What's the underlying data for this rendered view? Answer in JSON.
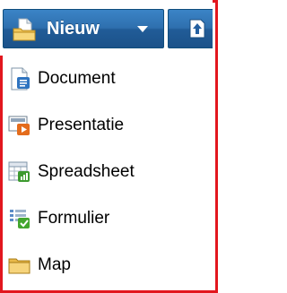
{
  "toolbar": {
    "new_button": {
      "label": "Nieuw",
      "icon": "new-document-folder-icon",
      "caret_icon": "caret-down-icon"
    },
    "upload_button": {
      "icon": "upload-arrow-icon"
    }
  },
  "menu": {
    "items": [
      {
        "label": "Document",
        "icon": "document-icon"
      },
      {
        "label": "Presentatie",
        "icon": "presentation-icon"
      },
      {
        "label": "Spreadsheet",
        "icon": "spreadsheet-icon"
      },
      {
        "label": "Formulier",
        "icon": "form-icon"
      },
      {
        "label": "Map",
        "icon": "folder-icon"
      }
    ]
  },
  "colors": {
    "frame_border": "#e2171e",
    "button_blue_top": "#3b84c6",
    "button_blue_bottom": "#1b5289",
    "button_border": "#0f4d7c",
    "menu_text": "#000000"
  }
}
